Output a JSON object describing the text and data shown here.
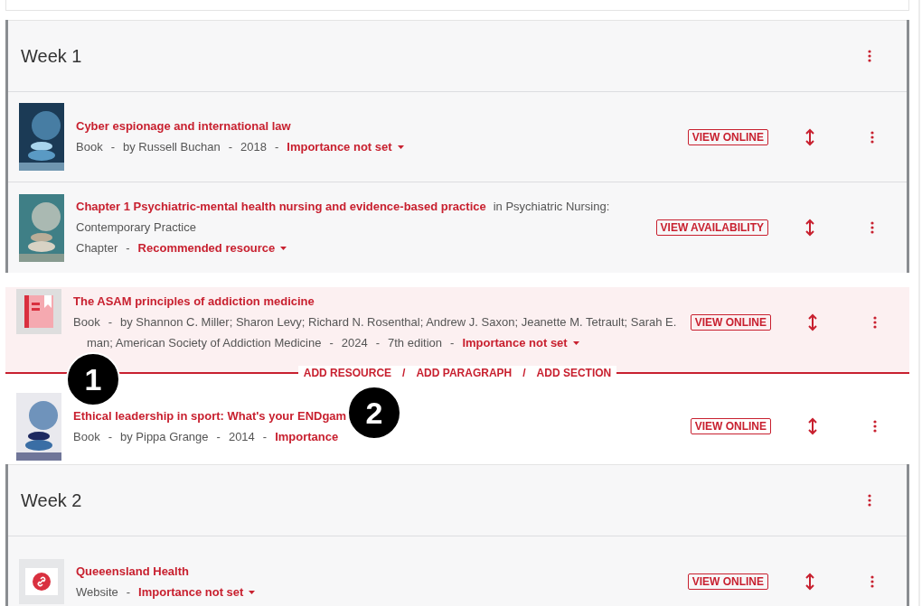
{
  "meta_separator": "-",
  "blocks": [
    {
      "kind": "section",
      "title": "Week 1",
      "items": [
        {
          "kind": "cover",
          "title": "Cyber espionage and international law",
          "type": "Book",
          "author_lines": [
            "by Russell Buchan"
          ],
          "year": "2018",
          "importance": "Importance not set",
          "caret": true,
          "action": "VIEW ONLINE",
          "highlighted": false
        },
        {
          "kind": "cover",
          "title": "Chapter 1 Psychiatric-mental health nursing and evidence-based practice",
          "context_lines": [
            "in Psychiatric Nursing:",
            "Contemporary Practice"
          ],
          "type": "Chapter",
          "importance": "Recommended resource",
          "caret": true,
          "action": "VIEW AVAILABILITY",
          "highlighted": false
        }
      ]
    },
    {
      "kind": "item",
      "item": {
        "kind": "book",
        "title": "The ASAM principles of addiction medicine",
        "type": "Book",
        "author_lines": [
          "by Shannon C. Miller; Sharon Levy; Richard N. Rosenthal; Andrew J. Saxon; Jeanette M. Tetrault; Sarah E.",
          "man; American Society of Addiction Medicine"
        ],
        "year": "2024",
        "edition": "7th edition",
        "importance": "Importance not set",
        "caret": true,
        "action": "VIEW ONLINE",
        "highlighted": true
      }
    },
    {
      "kind": "insert",
      "links": [
        "ADD RESOURCE",
        "ADD PARAGRAPH",
        "ADD SECTION"
      ],
      "separator": "/"
    },
    {
      "kind": "item",
      "item": {
        "kind": "cover",
        "title": "Ethical leadership in sport: What's your ENDgam",
        "type": "Book",
        "author_lines": [
          "by Pippa Grange"
        ],
        "year": "2014",
        "importance": "Importance",
        "caret": false,
        "action": "VIEW ONLINE",
        "highlighted": false
      }
    },
    {
      "kind": "section",
      "title": "Week 2",
      "items": [
        {
          "kind": "link",
          "title": "Queeensland Health",
          "type": "Website",
          "importance": "Importance not set",
          "caret": true,
          "action": "VIEW ONLINE",
          "highlighted": false
        }
      ]
    }
  ],
  "callouts": [
    "1",
    "2"
  ]
}
